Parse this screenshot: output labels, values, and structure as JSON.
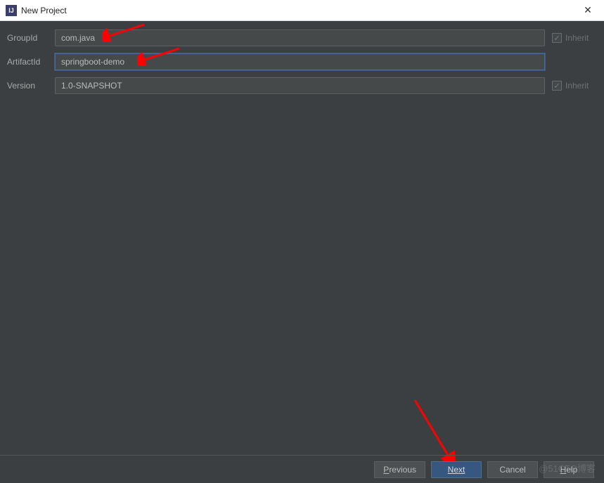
{
  "titlebar": {
    "title": "New Project",
    "icon_text": "IJ"
  },
  "form": {
    "group_id": {
      "label": "GroupId",
      "value": "com.java",
      "inherit_label": "Inherit"
    },
    "artifact_id": {
      "label": "ArtifactId",
      "value": "springboot-demo"
    },
    "version": {
      "label": "Version",
      "value": "1.0-SNAPSHOT",
      "inherit_label": "Inherit"
    }
  },
  "buttons": {
    "previous": "Previous",
    "next": "Next",
    "cancel": "Cancel",
    "help": "Help"
  },
  "watermark": "@51CTO博客"
}
